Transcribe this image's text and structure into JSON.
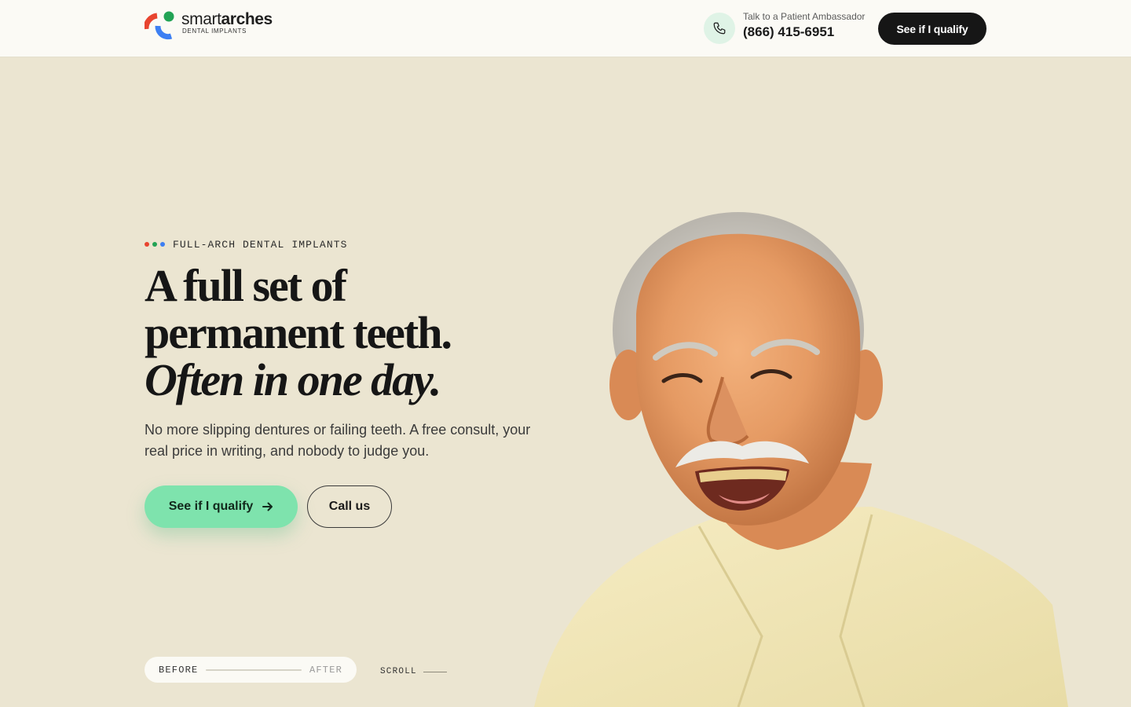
{
  "header": {
    "logo": {
      "name_light": "smart",
      "name_bold": "arches",
      "tagline": "DENTAL IMPLANTS",
      "colors": {
        "red": "#e8442f",
        "green": "#22a355",
        "blue": "#3d7ff2"
      }
    },
    "contact": {
      "icon": "phone-icon",
      "label": "Talk to a Patient Ambassador",
      "phone": "(866) 415-6951"
    },
    "cta_label": "See if I qualify"
  },
  "hero": {
    "eyebrow": {
      "dot_colors": [
        "#e8442f",
        "#22a355",
        "#3d7ff2"
      ],
      "text": "FULL-ARCH DENTAL IMPLANTS"
    },
    "headline": {
      "line1": "A full set of",
      "line2": "permanent teeth.",
      "line3_italic": "Often in one day."
    },
    "subcopy": "No more slipping dentures or failing teeth. A free consult, your real price in writing, and nobody to judge you.",
    "primary_cta": {
      "label": "See if I qualify",
      "icon": "arrow-right-icon"
    },
    "secondary_cta": {
      "label": "Call us"
    },
    "before_after": {
      "before": "BEFORE",
      "after": "AFTER"
    },
    "scroll_label": "SCROLL"
  },
  "colors": {
    "page_bg": "#ebe5d1",
    "header_bg": "#fbfaf5",
    "primary_button": "#7ee3ad",
    "dark_button": "#161616"
  }
}
